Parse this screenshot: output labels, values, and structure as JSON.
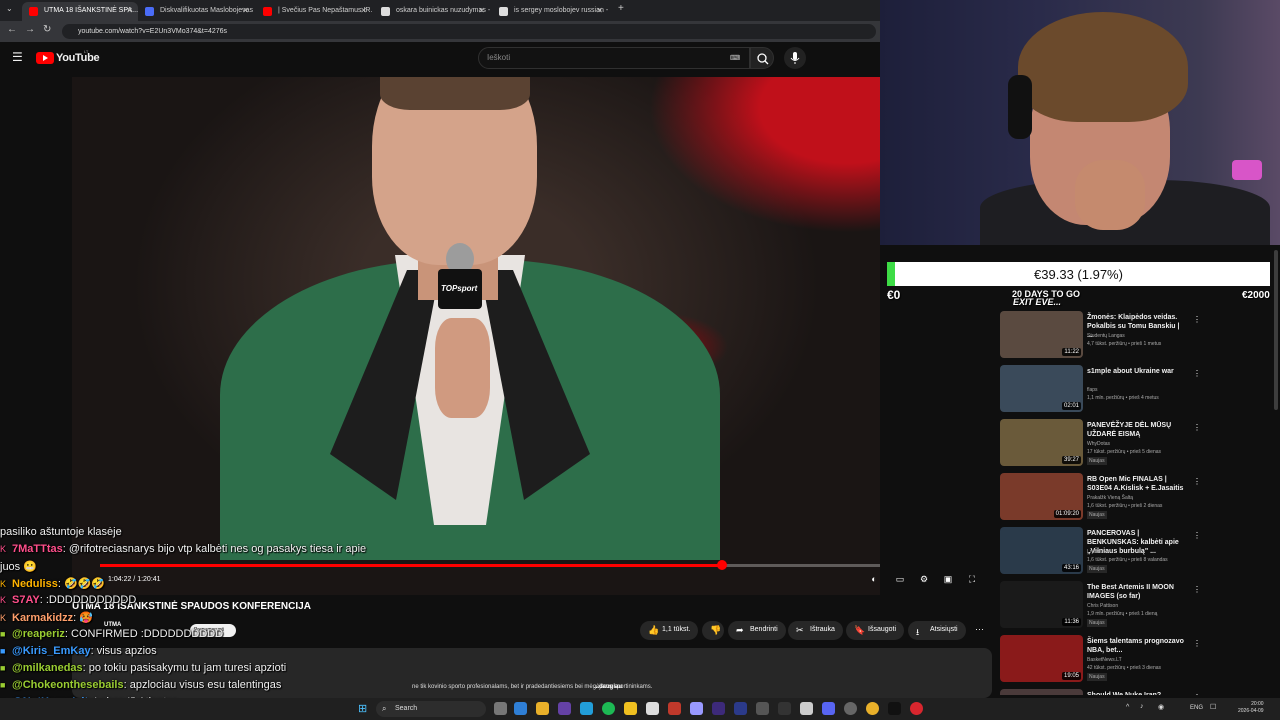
{
  "browser": {
    "tabs": [
      {
        "label": "UTMA 18 IŠANKSTINĖ SPA...",
        "active": true,
        "fav": "#ff0000"
      },
      {
        "label": "Diskvalifikuotas Maslobojevas",
        "active": false,
        "fav": "#4a6cf7"
      },
      {
        "label": "| Svečius Pas Nepaštamus IR...",
        "active": false,
        "fav": "#ff0000"
      },
      {
        "label": "oskara buinickas nuzudymas -",
        "active": false,
        "fav": "#dddddd"
      },
      {
        "label": "is sergey moslobojev russian -",
        "active": false,
        "fav": "#dddddd"
      }
    ],
    "url": "youtube.com/watch?v=E2Un3VMo374&t=4276s"
  },
  "youtube": {
    "brand": "YouTube",
    "brand_region": "LT",
    "search_placeholder": "Ieškoti",
    "player": {
      "time": "1:04:22 / 1:20:41",
      "progress_fraction": 0.797,
      "mic_label": "TOPsport"
    },
    "video_title": "UTMA 18 IŠANKSTINĖ SPAUDOS KONFERENCIJA",
    "channel": "UTMA",
    "subscribe_label": "Prenumeruoti",
    "actions": [
      {
        "label": "1,1 tūkst.",
        "icon": "thumbs-up-icon"
      },
      {
        "label": "",
        "icon": "thumbs-down-icon"
      },
      {
        "label": "Bendrinti",
        "icon": "share-icon"
      },
      {
        "label": "Ištrauka",
        "icon": "scissors-icon"
      },
      {
        "label": "Išsaugoti",
        "icon": "bookmark-icon"
      },
      {
        "label": "Atsisiųsti",
        "icon": "download-icon"
      }
    ],
    "description_snippet": "ne tik kovinio sporto profesionalams, bet ir pradedantiesiems bei mėgėjams sportininkams.",
    "description_more": "...daugiau"
  },
  "chat": [
    {
      "user": "",
      "text": "pasiliko aštuntoje klasėje",
      "color": "#ffffff",
      "badge": ""
    },
    {
      "user": "7MaTTtas",
      "text": ": @rifotreciasnarys bijo vtp kalbėti nes og pasakys tiesa ir apie",
      "color": "#ff4f8b",
      "badge": "K"
    },
    {
      "user": "",
      "text": "juos 😬",
      "color": "#ffffff",
      "badge": ""
    },
    {
      "user": "Neduliss",
      "text": ": 🤣🤣🤣",
      "color": "#ffb300",
      "badge": "K"
    },
    {
      "user": "S7AY",
      "text": ": :DDDDDDDDDDD",
      "color": "#ff4f8b",
      "badge": "K"
    },
    {
      "user": "Karmakidzz",
      "text": ": 🥵",
      "color": "#ff9f6b",
      "badge": "K"
    },
    {
      "user": "@reaperiz",
      "text": ": CONFIRMED :DDDDDDDDDD",
      "color": "#9acd32",
      "badge": "■"
    },
    {
      "user": "@Kiris_EmKay",
      "text": ": visus apzios",
      "color": "#3a9bff",
      "badge": "■"
    },
    {
      "user": "@milkanedas",
      "text": ": po tokiu pasisakymu tu jam turesi apzioti",
      "color": "#9acd32",
      "badge": "■"
    },
    {
      "user": "@Chokeonthesebails",
      "text": ": apzlociau visus esu talentingas",
      "color": "#9acd32",
      "badge": "■"
    },
    {
      "user": "@NotHomoIsit",
      "text": ": Labas Iš Atlantos",
      "color": "#3a9bff",
      "badge": "■"
    }
  ],
  "donation": {
    "amount": "€39.33 (1.97%)",
    "fraction": 0.0197,
    "min": "€0",
    "max": "€2000",
    "countdown": "20 DAYS TO GO",
    "event": "EXIT EVE..."
  },
  "sidebar": {
    "recommendations": [
      {
        "title": "Žmonės: Klaipėdos veidas. Pokalbis su Tomu Banskiu | ...",
        "channel": "Studentų Langas",
        "meta": "4,7 tūkst. peržiūrų • prieš 1 metus",
        "duration": "11:22",
        "new": "",
        "color": "#5a4a40"
      },
      {
        "title": "s1mple about Ukraine war",
        "channel": "flaps",
        "meta": "1,1 mln. peržiūrų • prieš 4 metus",
        "duration": "02:01",
        "new": "",
        "color": "#3a4a5a"
      },
      {
        "title": "PANEVĖŽYJE DĖL MŪSŲ UŽDARĖ EISMĄ",
        "channel": "WhyDotas",
        "meta": "17 tūkst. peržiūrų • prieš 5 dienas",
        "duration": "39:27",
        "new": "Naujas",
        "color": "#6a5a3a"
      },
      {
        "title": "RB Open Mic FINALAS | S03E04 A.Kislisk + E.Jasaitis",
        "channel": "Prakalžk Vieną Šaltą",
        "meta": "1,6 tūkst. peržiūrų • prieš 2 dienas",
        "duration": "01:09:20",
        "new": "Naujas",
        "color": "#7a3a2a"
      },
      {
        "title": "PANCEROVAS | BENKUNSKAS: kalbėti apie „Vilniaus burbulą\" ...",
        "channel": "Lrytas.lt",
        "meta": "1,6 tūkst. peržiūrų • prieš 8 valandas",
        "duration": "43:16",
        "new": "Naujas",
        "color": "#2a3a4a"
      },
      {
        "title": "The Best Artemis II MOON IMAGES (so far)",
        "channel": "Chris Pattison",
        "meta": "1,9 mln. peržiūrų • prieš 1 dieną",
        "duration": "11:36",
        "new": "Naujas",
        "color": "#1a1a1a"
      },
      {
        "title": "Šiems talentams prognozavo NBA, bet...",
        "channel": "BasketNews.LT",
        "meta": "42 tūkst. peržiūrų • prieš 3 dienas",
        "duration": "19:05",
        "new": "Naujas",
        "color": "#8a1a1a"
      },
      {
        "title": "Should We Nuke Iran?",
        "channel": "",
        "meta": "",
        "duration": "",
        "new": "",
        "color": "#4a3a3a"
      }
    ]
  },
  "taskbar": {
    "search_label": "Search",
    "lang": "ENG",
    "time": "20:00",
    "date": "2026-04-09"
  }
}
